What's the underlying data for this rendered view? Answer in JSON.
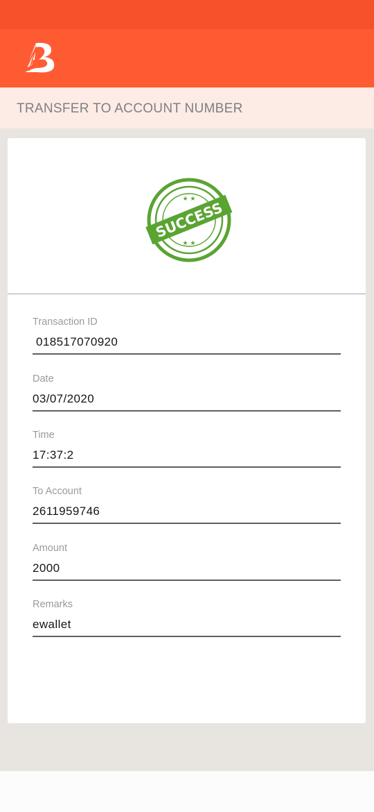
{
  "header": {
    "logo_icon": "bank-of-baroda-logo-icon",
    "background_color": "#ff5b33",
    "status_bar_color": "#f5512a"
  },
  "subheader": {
    "title": "TRANSFER TO ACCOUNT NUMBER"
  },
  "receipt": {
    "stamp_text": "SUCCESS",
    "stamp_color": "#5aa432",
    "fields": [
      {
        "label": "Transaction ID",
        "value": "018517070920"
      },
      {
        "label": "Date",
        "value": "03/07/2020"
      },
      {
        "label": "Time",
        "value": "17:37:2"
      },
      {
        "label": "To Account",
        "value": "2611959746"
      },
      {
        "label": "Amount",
        "value": "2000"
      },
      {
        "label": "Remarks",
        "value": "ewallet"
      }
    ]
  }
}
